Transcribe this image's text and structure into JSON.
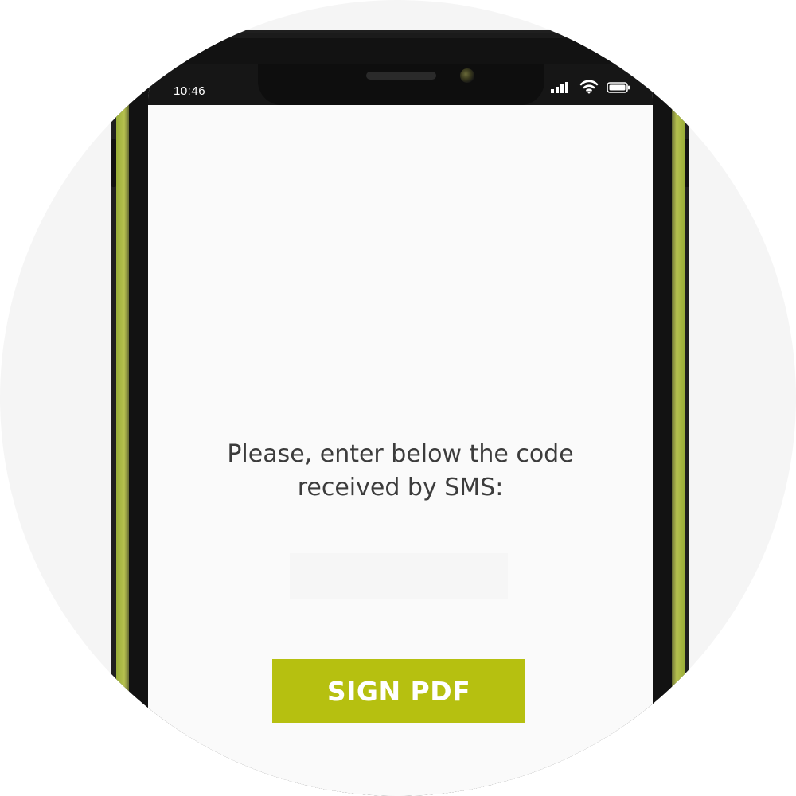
{
  "status_bar": {
    "time": "10:46",
    "icons": [
      "signal-icon",
      "wifi-icon",
      "battery-icon"
    ]
  },
  "main": {
    "prompt_line1": "Please, enter below the code",
    "prompt_line2": "received by SMS:",
    "code_input": {
      "value": "",
      "placeholder": ""
    },
    "sign_button_label": "SIGN PDF"
  },
  "colors": {
    "accent": "#b6c010",
    "phone_trim": "#a8b742",
    "screen_bg": "#fafafa",
    "backdrop": "#f5f5f5"
  }
}
